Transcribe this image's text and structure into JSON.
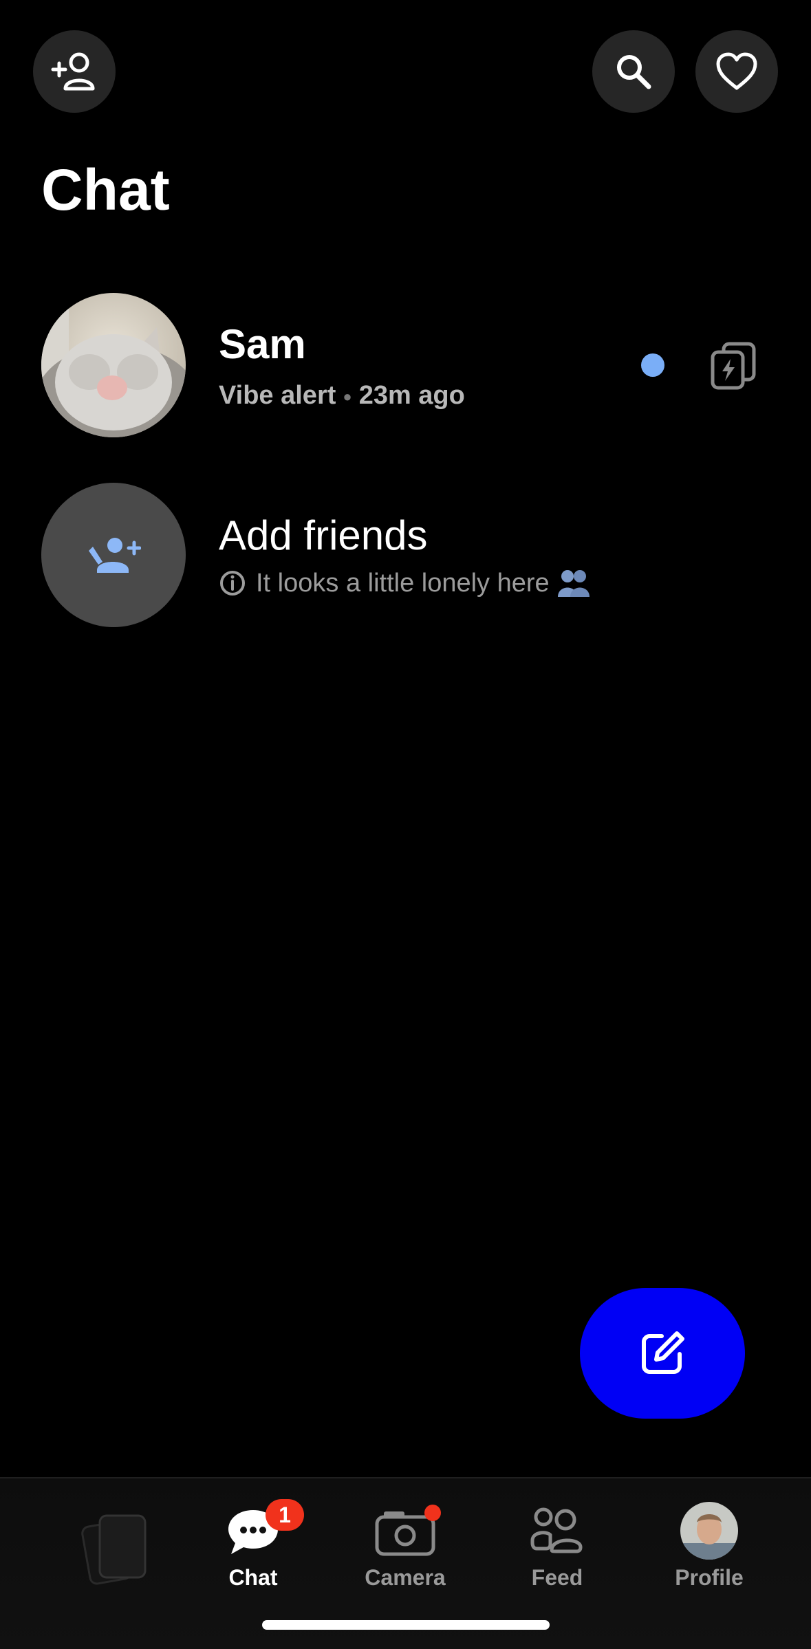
{
  "header": {
    "title": "Chat",
    "add_friend_icon": "add-person-icon",
    "search_icon": "search-icon",
    "favorites_icon": "heart-icon"
  },
  "chats": [
    {
      "name": "Sam",
      "status": "Vibe alert",
      "time": "23m ago",
      "unread": true,
      "action_icon": "flash-cards-icon"
    }
  ],
  "add_friends": {
    "title": "Add friends",
    "hint": "It looks a little lonely here"
  },
  "fab": {
    "icon": "compose-icon"
  },
  "tabs": [
    {
      "label": "",
      "icon": "cards-stack-icon"
    },
    {
      "label": "Chat",
      "icon": "chat-bubble-icon",
      "badge": "1",
      "active": true
    },
    {
      "label": "Camera",
      "icon": "camera-icon"
    },
    {
      "label": "Feed",
      "icon": "friends-icon"
    },
    {
      "label": "Profile",
      "icon": "profile-avatar"
    }
  ],
  "colors": {
    "background": "#000000",
    "accent_blue": "#0000f5",
    "unread_dot": "#7aaef7",
    "badge_red": "#f1321c",
    "button_bg": "#262626"
  }
}
